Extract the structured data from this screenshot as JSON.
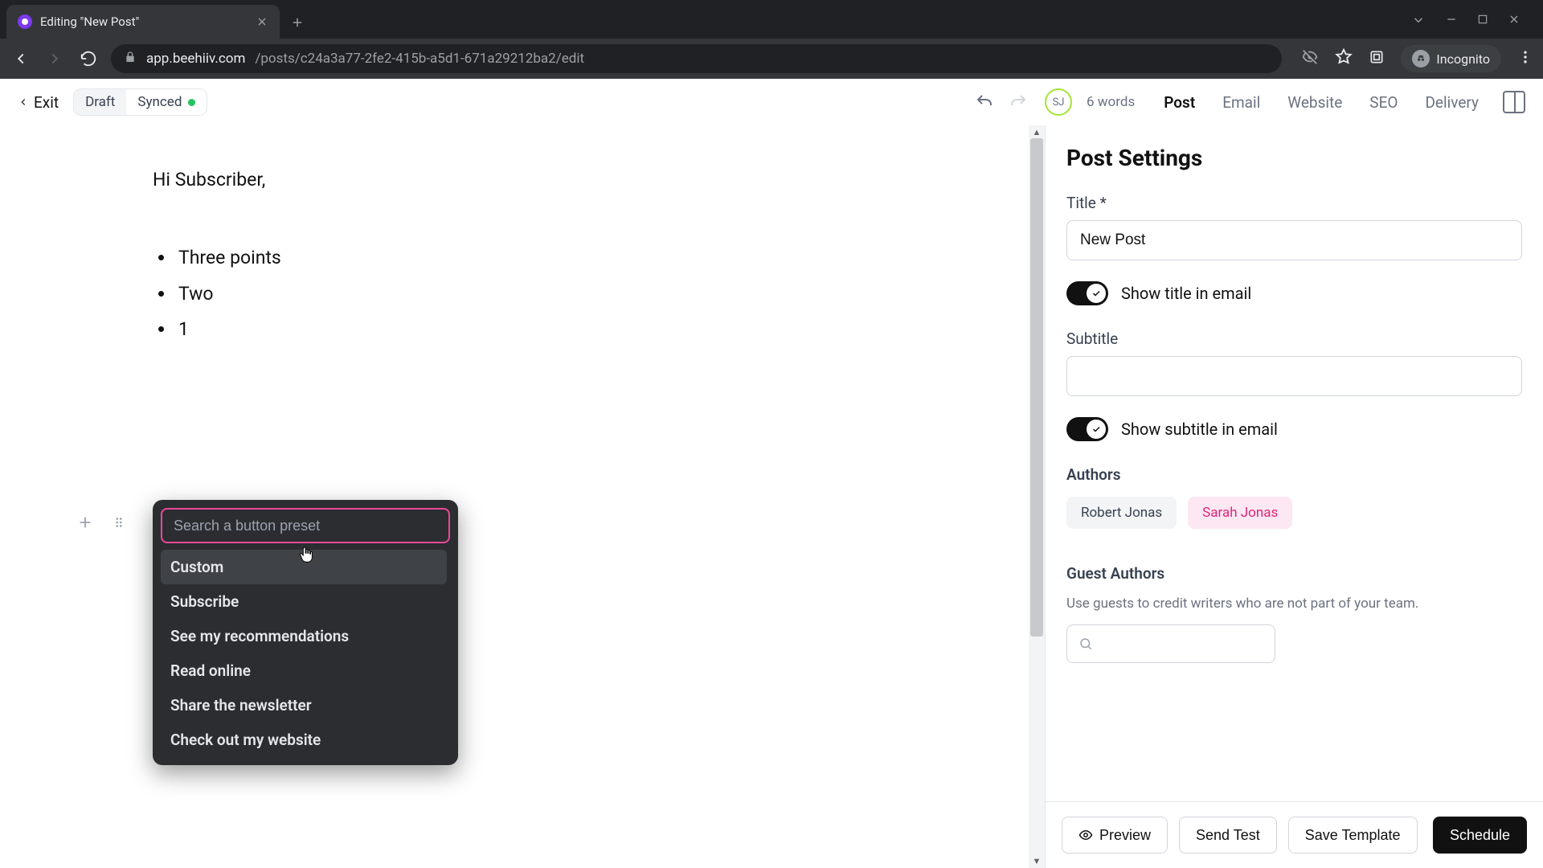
{
  "browser": {
    "tab_title": "Editing \"New Post\"",
    "url_domain": "app.beehiiv.com",
    "url_path": "/posts/c24a3a77-2fe2-415b-a5d1-671a29212ba2/edit",
    "incognito_label": "Incognito"
  },
  "topbar": {
    "exit": "Exit",
    "draft": "Draft",
    "synced": "Synced",
    "avatar_initials": "SJ",
    "word_count": "6 words",
    "tabs": [
      "Post",
      "Email",
      "Website",
      "SEO",
      "Delivery"
    ],
    "active_tab_index": 0
  },
  "editor": {
    "greeting": "Hi Subscriber,",
    "bullets": [
      "Three points",
      "Two",
      "1"
    ]
  },
  "preset_popup": {
    "search_placeholder": "Search a button preset",
    "items": [
      "Custom",
      "Subscribe",
      "See my recommendations",
      "Read online",
      "Share the newsletter",
      "Check out my website"
    ],
    "hover_index": 0
  },
  "panel": {
    "heading": "Post Settings",
    "title_label": "Title *",
    "title_value": "New Post",
    "show_title_label": "Show title in email",
    "subtitle_label": "Subtitle",
    "subtitle_value": "",
    "show_subtitle_label": "Show subtitle in email",
    "authors_label": "Authors",
    "authors": [
      {
        "name": "Robert Jonas",
        "kind": "gray"
      },
      {
        "name": "Sarah Jonas",
        "kind": "pink"
      }
    ],
    "guest_authors_label": "Guest Authors",
    "guest_authors_help": "Use guests to credit writers who are not part of your team.",
    "footer": {
      "preview": "Preview",
      "send_test": "Send Test",
      "save_template": "Save Template",
      "schedule": "Schedule"
    }
  }
}
